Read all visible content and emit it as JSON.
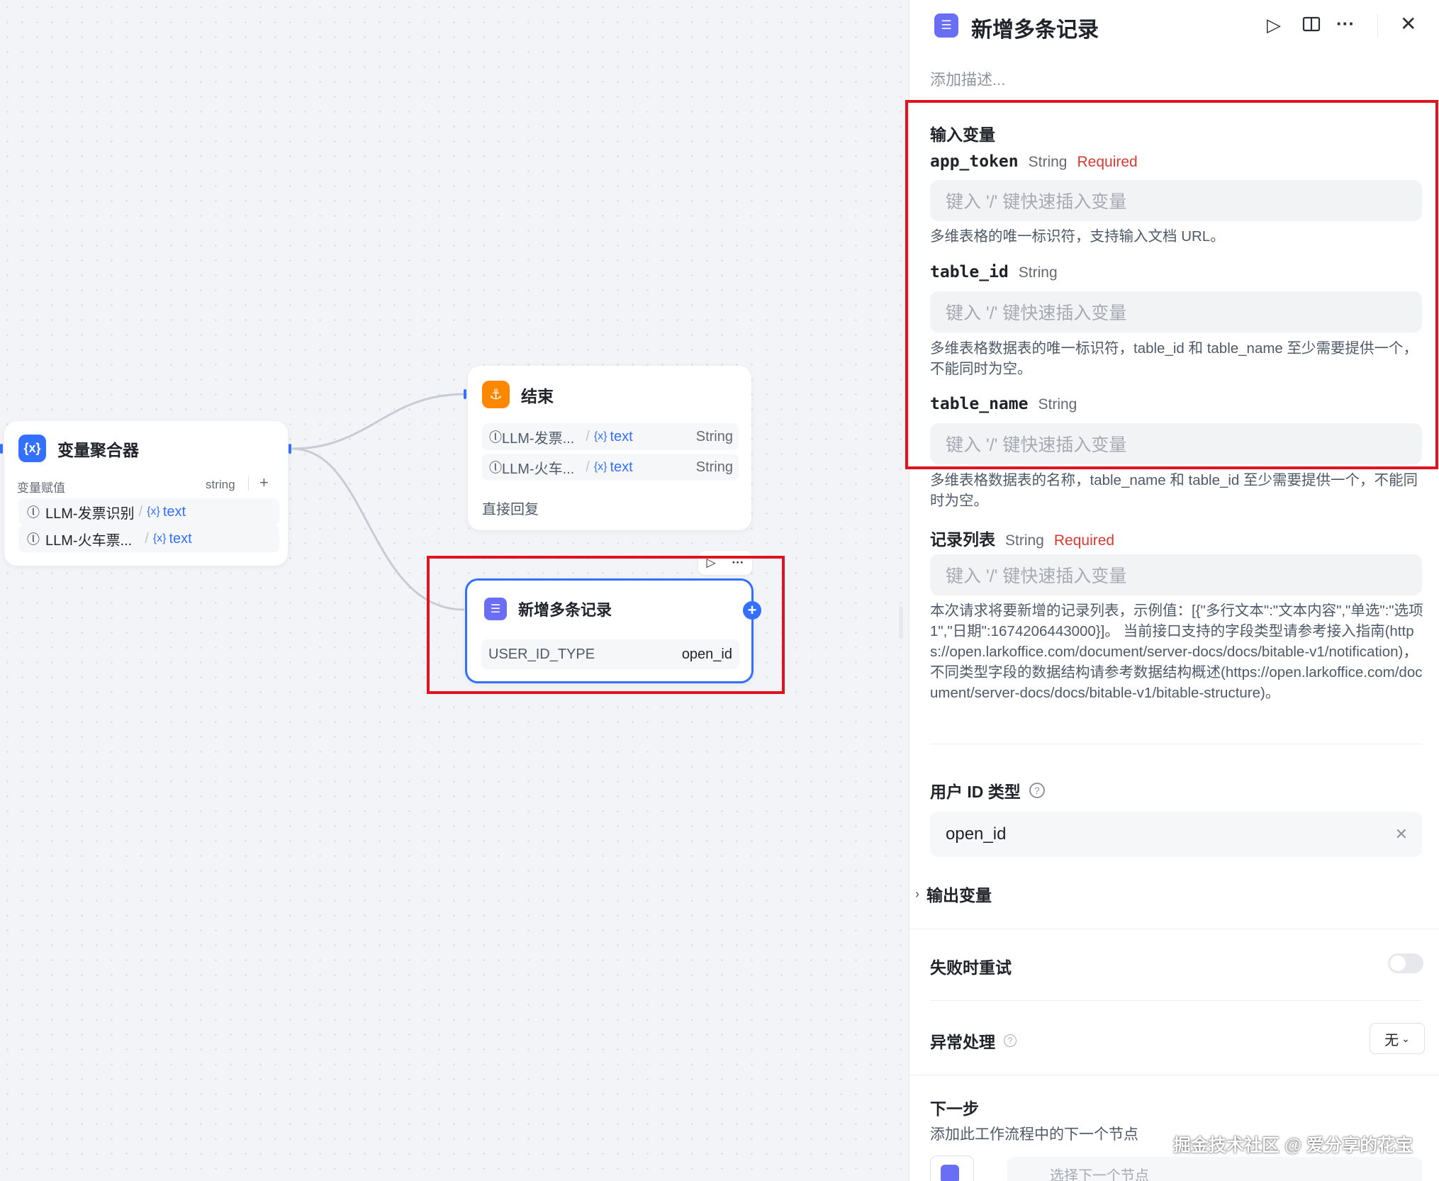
{
  "canvas": {
    "aggregator": {
      "title": "变量聚合器",
      "section_label": "变量赋值",
      "type_label": "string",
      "add_symbol": "+",
      "rows": [
        {
          "source": "LLM-发票识别",
          "var": "text"
        },
        {
          "source": "LLM-火车票...",
          "var": "text"
        }
      ]
    },
    "end_node": {
      "title": "结束",
      "rows": [
        {
          "source": "LLM-发票...",
          "var": "text",
          "type": "String"
        },
        {
          "source": "LLM-火车...",
          "var": "text",
          "type": "String"
        }
      ],
      "footer": "直接回复"
    },
    "record_node": {
      "title": "新增多条记录",
      "param_label": "USER_ID_TYPE",
      "param_value": "open_id"
    }
  },
  "panel": {
    "title": "新增多条记录",
    "description_placeholder": "添加描述...",
    "inputs_title": "输入变量",
    "fields": [
      {
        "name": "app_token",
        "type": "String",
        "required": "Required",
        "placeholder": "键入 '/' 键快速插入变量",
        "desc": "多维表格的唯一标识符，支持输入文档 URL。"
      },
      {
        "name": "table_id",
        "type": "String",
        "placeholder": "键入 '/' 键快速插入变量",
        "desc": "多维表格数据表的唯一标识符，table_id 和 table_name 至少需要提供一个，不能同时为空。"
      },
      {
        "name": "table_name",
        "type": "String",
        "placeholder": "键入 '/' 键快速插入变量",
        "desc": "多维表格数据表的名称，table_name 和 table_id 至少需要提供一个，不能同时为空。"
      },
      {
        "name": "记录列表",
        "type": "String",
        "required": "Required",
        "placeholder": "键入 '/' 键快速插入变量",
        "desc": "本次请求将要新增的记录列表，示例值：[{\"多行文本\":\"文本内容\",\"单选\":\"选项 1\",\"日期\":1674206443000}]。 当前接口支持的字段类型请参考接入指南(https://open.larkoffice.com/document/server-docs/docs/bitable-v1/notification)，不同类型字段的数据结构请参考数据结构概述(https://open.larkoffice.com/document/server-docs/docs/bitable-v1/bitable-structure)。"
      }
    ],
    "user_id_type": {
      "label": "用户 ID 类型",
      "value": "open_id"
    },
    "outputs_title": "输出变量",
    "retry_title": "失败时重试",
    "exception_title": "异常处理",
    "exception_value": "无",
    "next_step_title": "下一步",
    "next_step_desc": "添加此工作流程中的下一个节点",
    "next_step_select": "选择下一个节点"
  },
  "watermark": "掘金技术社区 @ 爱分享的花宝",
  "colors": {
    "accent": "#3370ff",
    "highlight": "#e0141e",
    "required": "#d83931",
    "end_icon": "#ff8800",
    "record_icon": "#6a6ef5"
  }
}
